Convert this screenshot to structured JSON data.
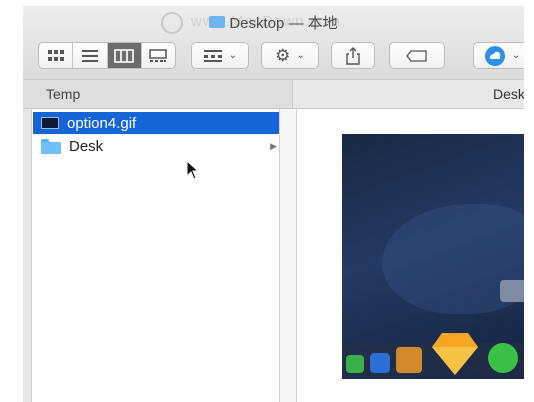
{
  "window": {
    "title": "Desktop — 本地",
    "watermark": "www.MacDown.com"
  },
  "toolbar": {
    "view_icon": "icon-view-icon",
    "view_list": "list-view-icon",
    "view_column": "column-view-icon",
    "view_gallery": "gallery-view-icon",
    "group_icon": "group-by-icon",
    "action_icon": "gear-icon",
    "share_icon": "share-icon",
    "tag_icon": "tag-icon",
    "cloud_icon": "cloud-sync-icon"
  },
  "columns": {
    "header_1": "Temp",
    "header_2": "Desk"
  },
  "files": [
    {
      "name": "option4.gif",
      "kind": "gif",
      "selected": true
    },
    {
      "name": "Desk",
      "kind": "folder",
      "selected": false
    }
  ],
  "colors": {
    "selection": "#1565d8",
    "folder": "#70bff7"
  }
}
